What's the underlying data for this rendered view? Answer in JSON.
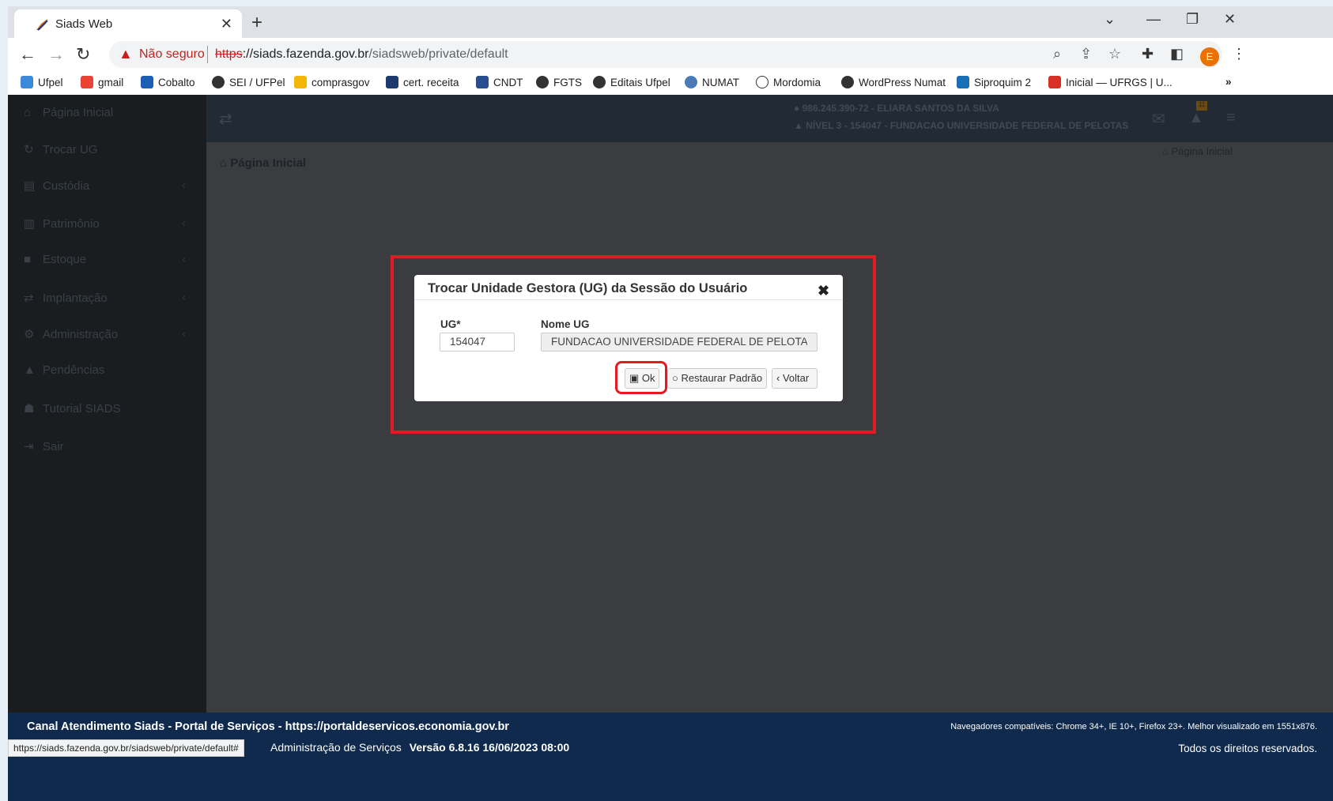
{
  "browser": {
    "tab_title": "Siads Web",
    "insecure_label": "Não seguro",
    "url_scheme": "https",
    "url_host": "://siads.fazenda.gov.br",
    "url_path": "/siadsweb/private/default",
    "profile_initial": "E",
    "status_url": "https://siads.fazenda.gov.br/siadsweb/private/default#",
    "bookmarks": [
      "Ufpel",
      "gmail",
      "Cobalto",
      "SEI / UFPel",
      "comprasgov",
      "cert. receita",
      "CNDT",
      "FGTS",
      "Editais Ufpel",
      "NUMAT",
      "Mordomia",
      "WordPress Numat",
      "Siproquim 2",
      "Inicial — UFRGS | U..."
    ]
  },
  "sidebar": {
    "items": [
      "Página Inicial",
      "Trocar UG",
      "Custódia",
      "Patrimônio",
      "Estoque",
      "Implantação",
      "Administração",
      "Pendências",
      "Tutorial SIADS",
      "Sair"
    ]
  },
  "header": {
    "user_line": "986.245.390-72 - ELIARA SANTOS DA SILVA",
    "level_line": "NÍVEL 3 - 154047 - FUNDACAO UNIVERSIDADE FEDERAL DE PELOTAS",
    "badge": "11"
  },
  "content": {
    "title": "Página Inicial",
    "breadcrumb": "Página Inicial"
  },
  "modal": {
    "title": "Trocar Unidade Gestora (UG) da Sessão do Usuário",
    "ug_label": "UG*",
    "ug_value": "154047",
    "name_label": "Nome UG",
    "name_value": "FUNDACAO UNIVERSIDADE FEDERAL DE PELOTAS",
    "ok_label": "Ok",
    "restore_label": "Restaurar Padrão",
    "back_label": "Voltar"
  },
  "footer": {
    "line1": "Canal Atendimento Siads - Portal de Serviços - https://portaldeservicos.economia.gov.br",
    "browsers": "Navegadores compatíveis: Chrome 34+, IE 10+, Firefox 23+. Melhor visualizado em 1551x876.",
    "admin": "Administração de Serviços",
    "version": "Versão 6.8.16 16/06/2023 08:00",
    "rights": "Todos os direitos reservados."
  },
  "colors": {
    "highlight": "#e21b23",
    "footer_bg": "#0f2a4d",
    "sidebar_bg": "#1a1d20"
  }
}
